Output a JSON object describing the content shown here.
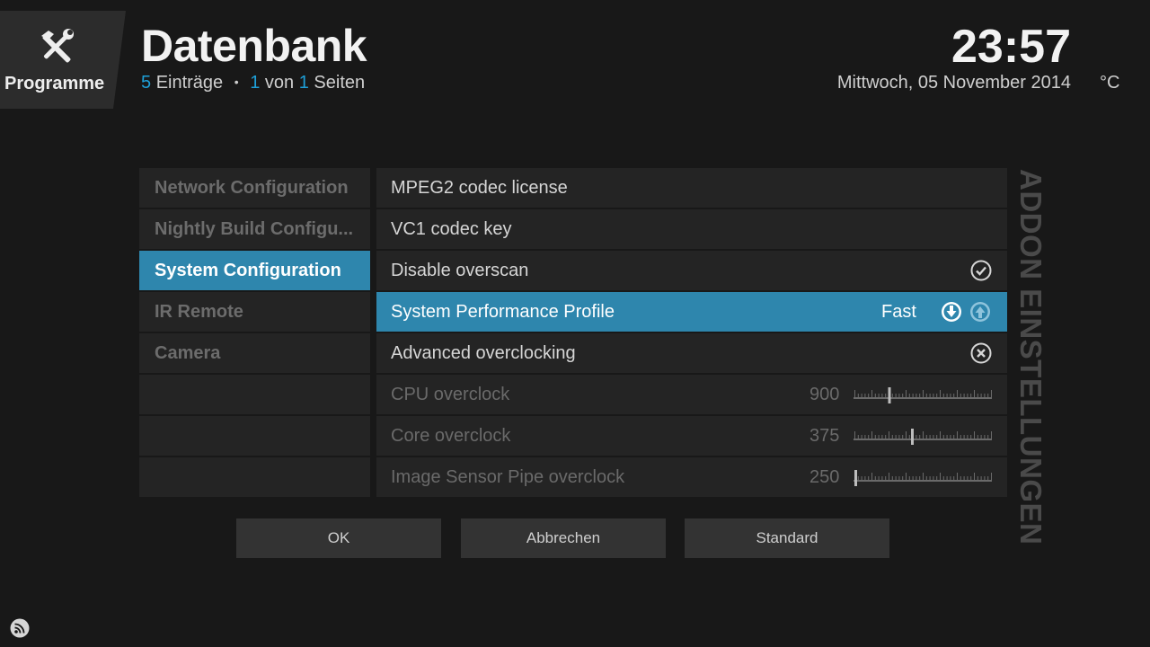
{
  "header": {
    "section_label": "Programme",
    "title": "Datenbank",
    "entries_count": "5",
    "entries_label": "Einträge",
    "separator": "•",
    "page_current": "1",
    "page_of_label": "von",
    "page_total": "1",
    "pages_label": "Seiten",
    "time": "23:57",
    "date": "Mittwoch, 05 November 2014",
    "temperature": "°C"
  },
  "categories": [
    {
      "label": "Network Configuration",
      "active": false
    },
    {
      "label": "Nightly Build Configu...",
      "active": false
    },
    {
      "label": "System Configuration",
      "active": true
    },
    {
      "label": "IR Remote",
      "active": false
    },
    {
      "label": "Camera",
      "active": false
    }
  ],
  "settings": [
    {
      "label": "MPEG2 codec license",
      "type": "text"
    },
    {
      "label": "VC1 codec key",
      "type": "text"
    },
    {
      "label": "Disable overscan",
      "type": "toggle",
      "state": "on",
      "icon": "check-circle-icon"
    },
    {
      "label": "System Performance Profile",
      "type": "spinner",
      "value": "Fast",
      "icons": [
        "arrow-down-circle-icon",
        "arrow-up-circle-icon"
      ]
    },
    {
      "label": "Advanced overclocking",
      "type": "toggle",
      "state": "off",
      "icon": "x-circle-icon"
    },
    {
      "label": "CPU overclock",
      "type": "slider",
      "value": "900",
      "level": 0.25,
      "disabled": true
    },
    {
      "label": "Core overclock",
      "type": "slider",
      "value": "375",
      "level": 0.42,
      "disabled": true
    },
    {
      "label": "Image Sensor Pipe overclock",
      "type": "slider",
      "value": "250",
      "level": 0.0,
      "disabled": true
    }
  ],
  "buttons": {
    "ok": "OK",
    "cancel": "Abbrechen",
    "default": "Standard"
  },
  "vertical_label": "ADDON EINSTELLUNGEN",
  "colors": {
    "accent": "#2e86ad",
    "highlight_number": "#1ea0d8",
    "background": "#181818"
  }
}
